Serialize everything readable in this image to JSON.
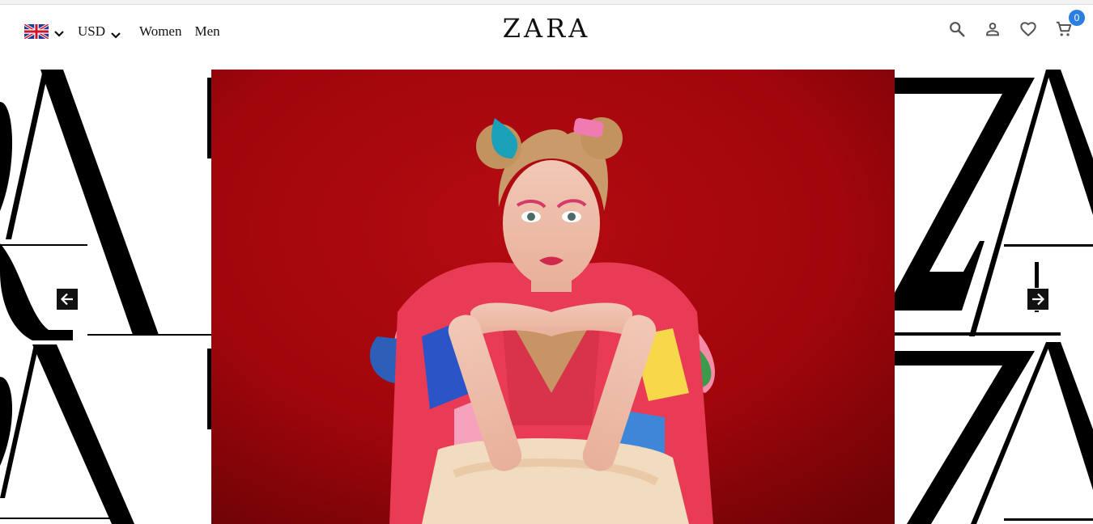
{
  "header": {
    "language": {
      "icon": "uk-flag-icon",
      "dropdown_icon": "chevron-down-icon"
    },
    "currency": {
      "label": "USD",
      "dropdown_icon": "chevron-down-icon"
    },
    "nav": [
      {
        "label": "Women"
      },
      {
        "label": "Men"
      }
    ],
    "brand": "ZARA",
    "actions": {
      "search_icon": "search-icon",
      "account_icon": "user-icon",
      "wishlist_icon": "heart-icon",
      "cart_icon": "cart-icon",
      "cart_count": "0"
    }
  },
  "carousel": {
    "prev_icon": "arrow-left-icon",
    "next_icon": "arrow-right-icon",
    "background_letters": "ZARA",
    "hero_image": "model-portrait-red-background"
  },
  "colors": {
    "accent": "#2a7de1",
    "hero_bg": "#a8070d",
    "text": "#111111"
  }
}
